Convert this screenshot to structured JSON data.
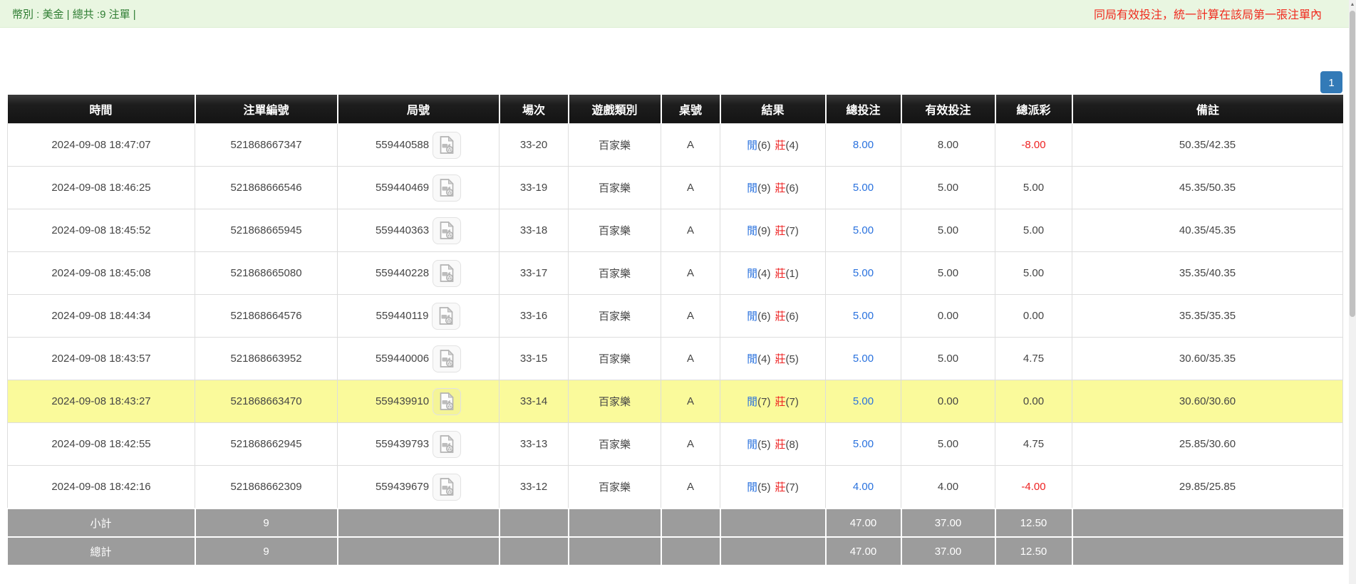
{
  "summary_bar": {
    "left_text": "幣別 : 美金 | 總共 :9 注單 |",
    "right_notice": "同局有效投注，統一計算在該局第一張注單內"
  },
  "pagination": {
    "current_page": "1"
  },
  "table": {
    "columns": [
      "時間",
      "注單編號",
      "局號",
      "場次",
      "遊戲類別",
      "桌號",
      "結果",
      "總投注",
      "有效投注",
      "總派彩",
      "備註"
    ],
    "rows": [
      {
        "time": "2024-09-08 18:47:07",
        "bet_id": "521868667347",
        "round_no": "559440588",
        "session": "33-20",
        "game": "百家樂",
        "table_no": "A",
        "result": {
          "player_label": "閒",
          "player_score": "(6)",
          "banker_label": "莊",
          "banker_score": "(4)"
        },
        "total_bet": "8.00",
        "valid_bet": "8.00",
        "payout": "-8.00",
        "remark": "50.35/42.35",
        "highlighted": false
      },
      {
        "time": "2024-09-08 18:46:25",
        "bet_id": "521868666546",
        "round_no": "559440469",
        "session": "33-19",
        "game": "百家樂",
        "table_no": "A",
        "result": {
          "player_label": "閒",
          "player_score": "(9)",
          "banker_label": "莊",
          "banker_score": "(6)"
        },
        "total_bet": "5.00",
        "valid_bet": "5.00",
        "payout": "5.00",
        "remark": "45.35/50.35",
        "highlighted": false
      },
      {
        "time": "2024-09-08 18:45:52",
        "bet_id": "521868665945",
        "round_no": "559440363",
        "session": "33-18",
        "game": "百家樂",
        "table_no": "A",
        "result": {
          "player_label": "閒",
          "player_score": "(9)",
          "banker_label": "莊",
          "banker_score": "(7)"
        },
        "total_bet": "5.00",
        "valid_bet": "5.00",
        "payout": "5.00",
        "remark": "40.35/45.35",
        "highlighted": false
      },
      {
        "time": "2024-09-08 18:45:08",
        "bet_id": "521868665080",
        "round_no": "559440228",
        "session": "33-17",
        "game": "百家樂",
        "table_no": "A",
        "result": {
          "player_label": "閒",
          "player_score": "(4)",
          "banker_label": "莊",
          "banker_score": "(1)"
        },
        "total_bet": "5.00",
        "valid_bet": "5.00",
        "payout": "5.00",
        "remark": "35.35/40.35",
        "highlighted": false
      },
      {
        "time": "2024-09-08 18:44:34",
        "bet_id": "521868664576",
        "round_no": "559440119",
        "session": "33-16",
        "game": "百家樂",
        "table_no": "A",
        "result": {
          "player_label": "閒",
          "player_score": "(6)",
          "banker_label": "莊",
          "banker_score": "(6)"
        },
        "total_bet": "5.00",
        "valid_bet": "0.00",
        "payout": "0.00",
        "remark": "35.35/35.35",
        "highlighted": false
      },
      {
        "time": "2024-09-08 18:43:57",
        "bet_id": "521868663952",
        "round_no": "559440006",
        "session": "33-15",
        "game": "百家樂",
        "table_no": "A",
        "result": {
          "player_label": "閒",
          "player_score": "(4)",
          "banker_label": "莊",
          "banker_score": "(5)"
        },
        "total_bet": "5.00",
        "valid_bet": "5.00",
        "payout": "4.75",
        "remark": "30.60/35.35",
        "highlighted": false
      },
      {
        "time": "2024-09-08 18:43:27",
        "bet_id": "521868663470",
        "round_no": "559439910",
        "session": "33-14",
        "game": "百家樂",
        "table_no": "A",
        "result": {
          "player_label": "閒",
          "player_score": "(7)",
          "banker_label": "莊",
          "banker_score": "(7)"
        },
        "total_bet": "5.00",
        "valid_bet": "0.00",
        "payout": "0.00",
        "remark": "30.60/30.60",
        "highlighted": true
      },
      {
        "time": "2024-09-08 18:42:55",
        "bet_id": "521868662945",
        "round_no": "559439793",
        "session": "33-13",
        "game": "百家樂",
        "table_no": "A",
        "result": {
          "player_label": "閒",
          "player_score": "(5)",
          "banker_label": "莊",
          "banker_score": "(8)"
        },
        "total_bet": "5.00",
        "valid_bet": "5.00",
        "payout": "4.75",
        "remark": "25.85/30.60",
        "highlighted": false
      },
      {
        "time": "2024-09-08 18:42:16",
        "bet_id": "521868662309",
        "round_no": "559439679",
        "session": "33-12",
        "game": "百家樂",
        "table_no": "A",
        "result": {
          "player_label": "閒",
          "player_score": "(5)",
          "banker_label": "莊",
          "banker_score": "(7)"
        },
        "total_bet": "4.00",
        "valid_bet": "4.00",
        "payout": "-4.00",
        "remark": "29.85/25.85",
        "highlighted": false
      }
    ],
    "footer": [
      {
        "label": "小計",
        "count": "9",
        "total_bet": "47.00",
        "valid_bet": "37.00",
        "payout": "12.50"
      },
      {
        "label": "總計",
        "count": "9",
        "total_bet": "47.00",
        "valid_bet": "37.00",
        "payout": "12.50"
      }
    ]
  },
  "icons": {
    "round_cell_icon": "video-replay-icon",
    "scrollbar_arrow": "up-arrow-icon"
  },
  "colors": {
    "accent_blue": "#2a72de",
    "player_blue": "#2a72de",
    "negative_red": "#ee2222",
    "highlight_yellow": "#fafa9b",
    "footer_gray": "#9c9c9c",
    "bar_bg": "#e9f6e1",
    "bar_text_green": "#2e7d32",
    "notice_red": "#f02a1e",
    "page_active_bg": "#337ab7"
  }
}
